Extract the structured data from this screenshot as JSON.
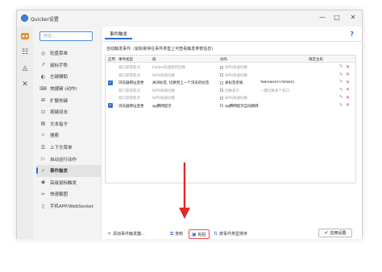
{
  "window": {
    "title": "Quicker设置",
    "minimize": "—",
    "maximize": "□",
    "close": "✕"
  },
  "sidebar": {
    "search_placeholder": "筛选...",
    "strip_icons": [
      "logo-icon",
      "sliders-icon",
      "shapes-icon",
      "tools-icon"
    ],
    "items": [
      {
        "label": "轮盘菜单",
        "icon": "◎"
      },
      {
        "label": "鼠标手势",
        "icon": "↗"
      },
      {
        "label": "左键辅助",
        "icon": "◐"
      },
      {
        "label": "快捷键 (动作)",
        "icon": "⌨"
      },
      {
        "label": "扩展热键",
        "icon": "⊞"
      },
      {
        "label": "按键双击",
        "icon": "⊡"
      },
      {
        "label": "文本指令",
        "icon": "▤"
      },
      {
        "label": "搜索",
        "icon": "⌕"
      },
      {
        "label": "上下文菜单",
        "icon": "☰"
      },
      {
        "label": "自动运行动作",
        "icon": "▷"
      },
      {
        "label": "事件触发",
        "icon": "⚡"
      },
      {
        "label": "高级鼠标触发",
        "icon": "◉"
      },
      {
        "label": "快速截图",
        "icon": "✂"
      },
      {
        "label": "手机APP/WebSocket",
        "icon": "▯"
      }
    ],
    "active_index": 10
  },
  "main": {
    "tab": "事件触发",
    "help": "?",
    "section_label": "自动触发事件: (鼠标悬停在事件类型上可查看触发参数信息)",
    "columns": [
      "启用",
      "事件类型",
      "值",
      "动作",
      "",
      "限定主机"
    ],
    "rows": [
      {
        "enabled": false,
        "type": "窗口获得焦点",
        "value": "Folder快速回到切换",
        "action": "WPS快速切换",
        "extra": "",
        "dim": true
      },
      {
        "enabled": false,
        "type": "窗口获得焦点",
        "value": "WPS快速切换",
        "action": "WPS快速切换",
        "extra": "",
        "dim": true
      },
      {
        "enabled": true,
        "type": "浏览器网址变更",
        "value": "关闭标签, 切换到上一个浏览的标签",
        "action": "关标签老板",
        "extra": "%Browser:[%tab4]",
        "dim": false
      },
      {
        "enabled": false,
        "type": "窗口获得焦点",
        "value": "WPS快速切换",
        "action": "切换多页",
        "extra": "一键切换多个窗口",
        "dim": true
      },
      {
        "enabled": false,
        "type": "窗口获得焦点",
        "value": "WPS快速切换",
        "action": "WPS快速切换",
        "extra": "",
        "dim": true
      },
      {
        "enabled": true,
        "type": "浏览器网址变更",
        "value": "qq腾网提示",
        "action": "qq腾网提示自动跳转",
        "extra": "",
        "dim": false
      }
    ],
    "footer": {
      "add": "添加事件触发器...",
      "copy": "复制",
      "paste": "粘贴",
      "sort": "按事件类型排序"
    }
  },
  "apply_button": "应用设置",
  "colors": {
    "accent": "#2f6bd8",
    "annotation_arrow": "#e02a2a",
    "delete": "#d64040"
  }
}
